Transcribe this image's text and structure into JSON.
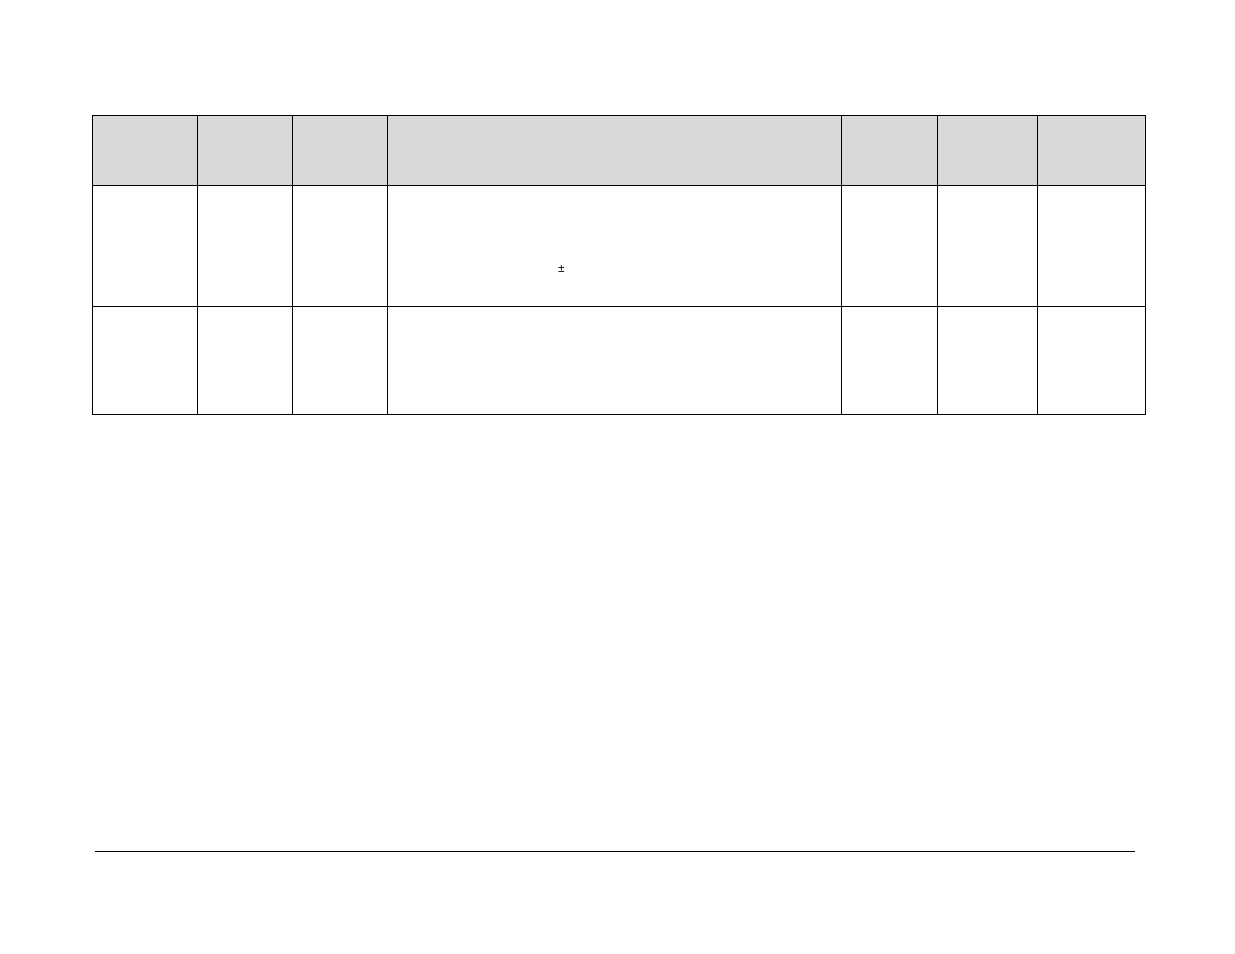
{
  "table": {
    "headers": [
      "",
      "",
      "",
      "",
      "",
      "",
      ""
    ],
    "rows": [
      {
        "cells": [
          "",
          "",
          "",
          "",
          "",
          "",
          ""
        ],
        "symbol": "±"
      },
      {
        "cells": [
          "",
          "",
          "",
          "",
          "",
          "",
          ""
        ]
      }
    ]
  }
}
